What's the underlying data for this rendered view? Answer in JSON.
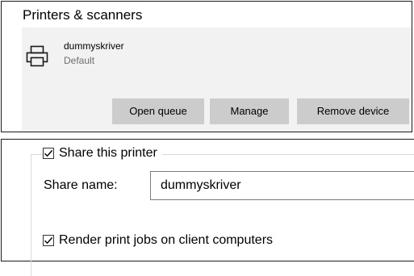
{
  "printers_panel": {
    "title": "Printers & scanners",
    "printer": {
      "name": "dummyskriver",
      "status": "Default",
      "icon": "printer-icon"
    },
    "buttons": {
      "open_queue": "Open queue",
      "manage": "Manage",
      "remove_device": "Remove device"
    }
  },
  "sharing_panel": {
    "share_checkbox_label": "Share this printer",
    "share_checked": true,
    "share_name_label": "Share name:",
    "share_name_value": "dummyskriver",
    "render_checkbox_label": "Render print jobs on client computers",
    "render_checked": true
  }
}
